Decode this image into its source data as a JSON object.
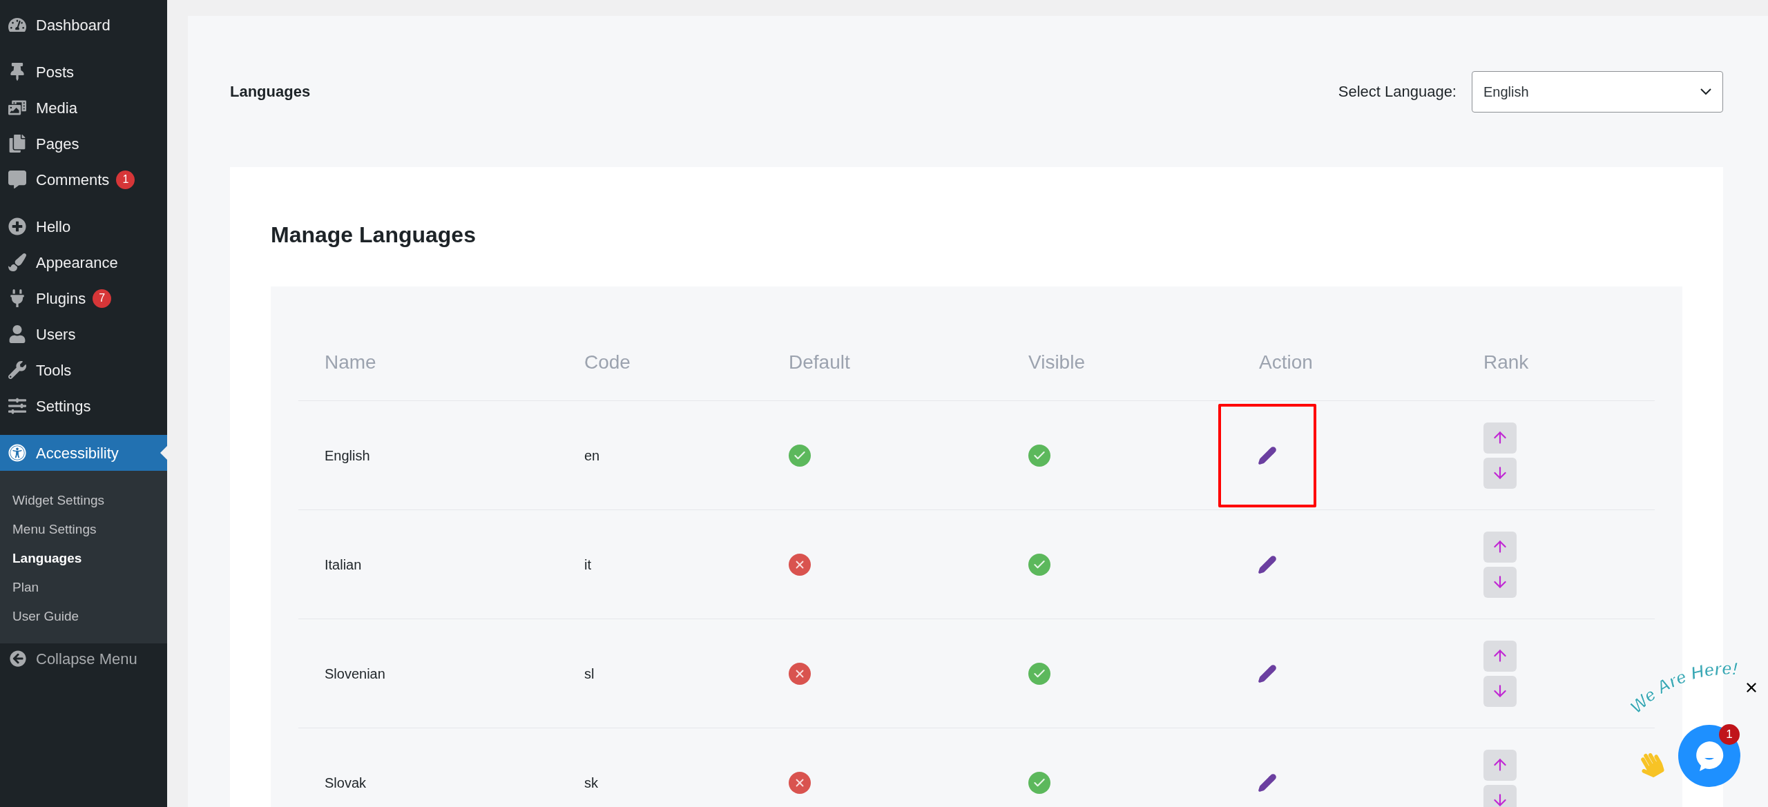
{
  "sidebar": {
    "groups": [
      [
        {
          "label": "Dashboard",
          "selected": false
        }
      ],
      [
        {
          "label": "Posts",
          "selected": false
        },
        {
          "label": "Media",
          "selected": false
        },
        {
          "label": "Pages",
          "selected": false
        },
        {
          "label": "Comments",
          "selected": false,
          "badge": "1"
        }
      ],
      [
        {
          "label": "Hello",
          "selected": false
        },
        {
          "label": "Appearance",
          "selected": false
        },
        {
          "label": "Plugins",
          "selected": false,
          "badge": "7"
        },
        {
          "label": "Users",
          "selected": false
        },
        {
          "label": "Tools",
          "selected": false
        },
        {
          "label": "Settings",
          "selected": false
        }
      ],
      [
        {
          "label": "Accessibility",
          "selected": true,
          "children": [
            {
              "label": "Widget Settings",
              "selected": false
            },
            {
              "label": "Menu Settings",
              "selected": false
            },
            {
              "label": "Languages",
              "selected": true
            },
            {
              "label": "Plan",
              "selected": false
            },
            {
              "label": "User Guide",
              "selected": false
            }
          ]
        }
      ]
    ],
    "collapse": "Collapse Menu"
  },
  "page": {
    "title": "Languages",
    "select": {
      "label": "Select Language:",
      "value": "English"
    }
  },
  "card": {
    "title": "Manage Languages",
    "table": {
      "columns": [
        "Name",
        "Code",
        "Default",
        "Visible",
        "Action",
        "Rank"
      ],
      "rows": [
        {
          "name": "English",
          "code": "en",
          "default": true,
          "visible": true,
          "highlighted": true
        },
        {
          "name": "Italian",
          "code": "it",
          "default": false,
          "visible": true,
          "highlighted": false
        },
        {
          "name": "Slovenian",
          "code": "sl",
          "default": false,
          "visible": true,
          "highlighted": false
        },
        {
          "name": "Slovak",
          "code": "sk",
          "default": false,
          "visible": true,
          "highlighted": false
        }
      ]
    }
  },
  "chat": {
    "tagline": "We Are Here!",
    "badge": "1"
  }
}
